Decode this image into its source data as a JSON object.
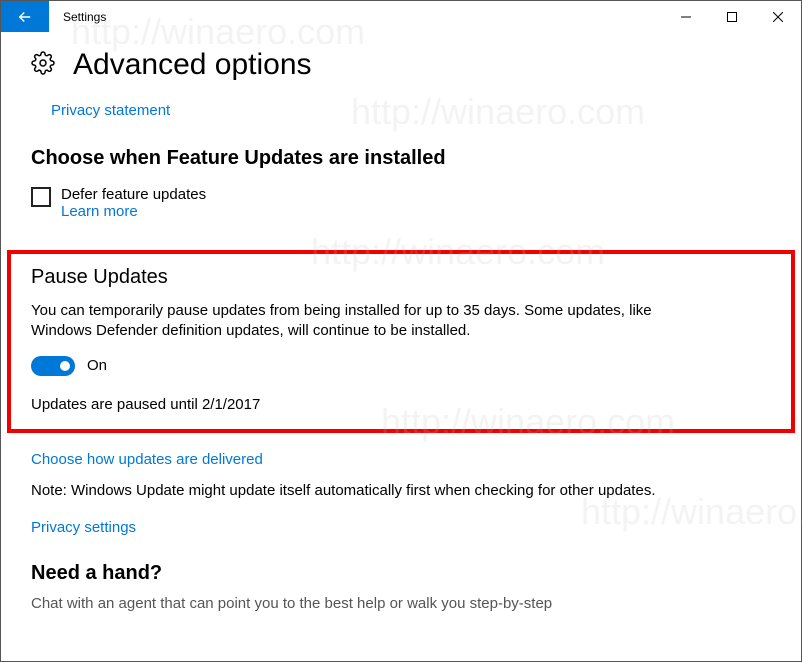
{
  "titlebar": {
    "app_name": "Settings"
  },
  "header": {
    "title": "Advanced options",
    "privacy_link": "Privacy statement"
  },
  "feature_updates": {
    "heading": "Choose when Feature Updates are installed",
    "defer_label": "Defer feature updates",
    "learn_more": "Learn more"
  },
  "pause": {
    "heading": "Pause Updates",
    "description": "You can temporarily pause updates from being installed for up to 35 days. Some updates, like Windows Defender definition updates, will continue to be installed.",
    "toggle_state": "On",
    "status": "Updates are paused until 2/1/2017"
  },
  "delivery": {
    "link": "Choose how updates are delivered"
  },
  "note": "Note: Windows Update might update itself automatically first when checking for other updates.",
  "privacy_settings_link": "Privacy settings",
  "help": {
    "heading": "Need a hand?",
    "text": "Chat with an agent that can point you to the best help or walk you step-by-step"
  },
  "watermark": "http://winaero.com"
}
